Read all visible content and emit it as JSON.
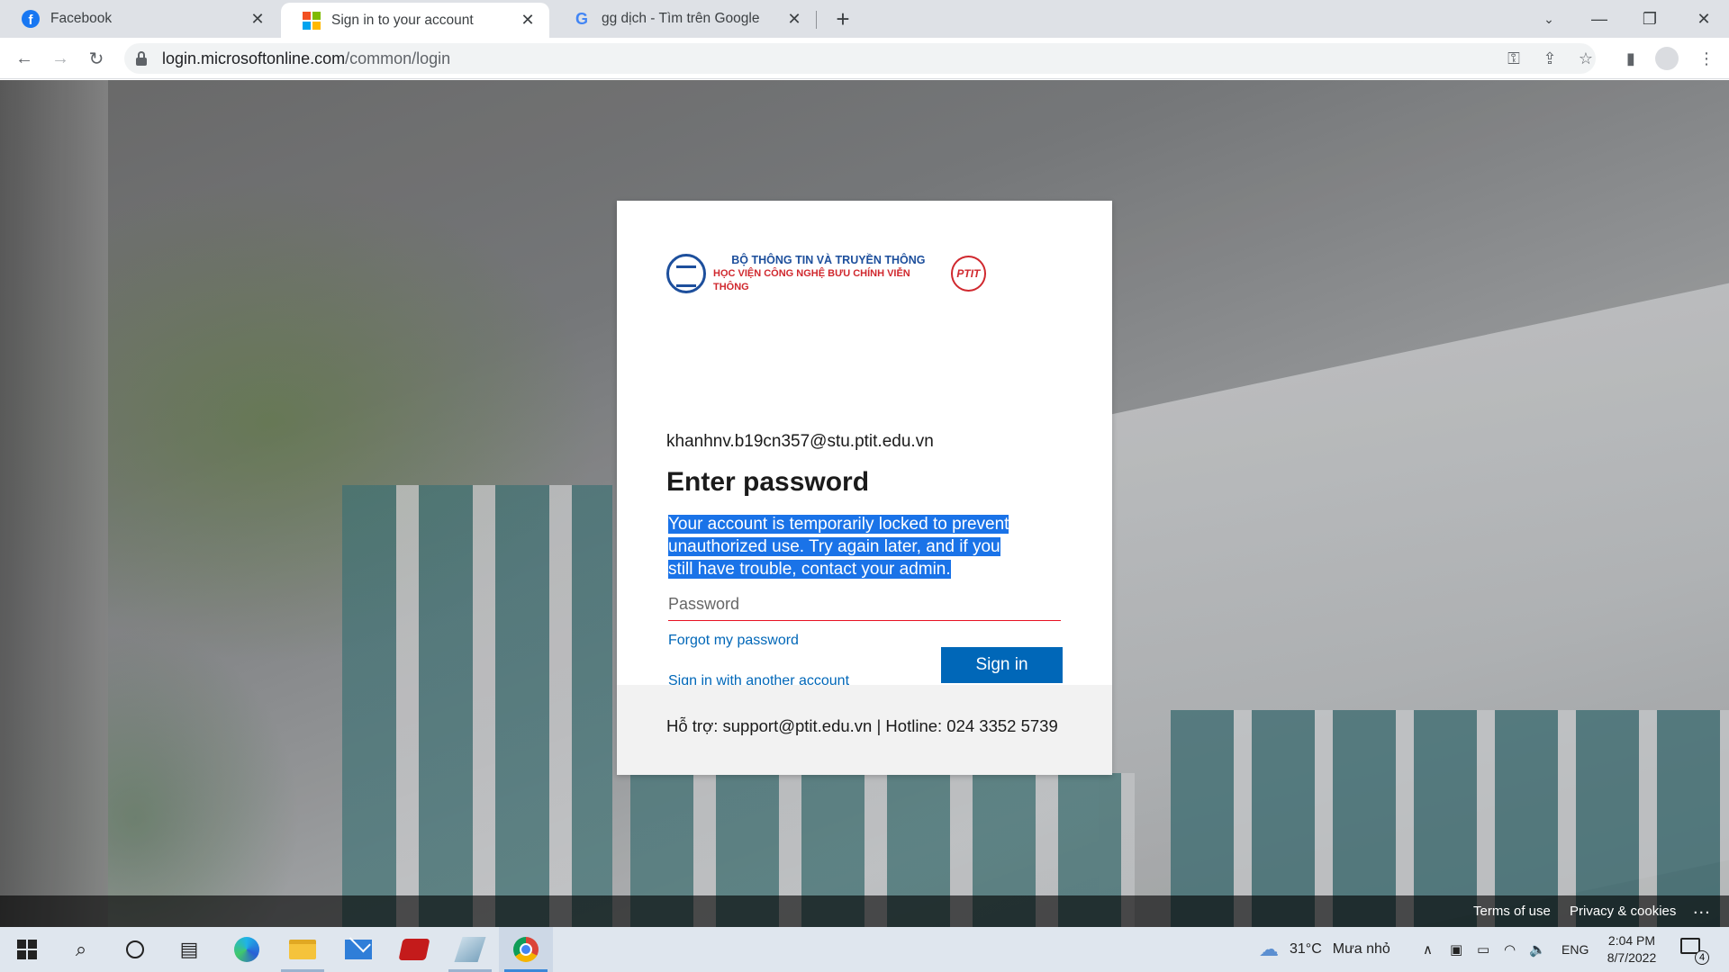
{
  "browser": {
    "tabs": [
      {
        "title": "Facebook",
        "favicon": "facebook-icon",
        "active": false
      },
      {
        "title": "Sign in to your account",
        "favicon": "microsoft-icon",
        "active": true
      },
      {
        "title": "gg dịch - Tìm trên Google",
        "favicon": "google-icon",
        "active": false
      }
    ],
    "url_host": "login.microsoftonline.com",
    "url_path": "/common/login"
  },
  "login": {
    "org_name_line1": "BỘ THÔNG TIN VÀ TRUYỀN THÔNG",
    "org_name_line2": "HỌC VIỆN CÔNG NGHỆ BƯU CHÍNH VIỄN THÔNG",
    "org_logo_text": "PTIT",
    "identity": "khanhnv.b19cn357@stu.ptit.edu.vn",
    "title": "Enter password",
    "error_message": "Your account is temporarily locked to prevent unauthorized use. Try again later, and if you still have trouble, contact your admin.",
    "password_placeholder": "Password",
    "forgot_password": "Forgot my password",
    "other_account": "Sign in with another account",
    "sign_in_button": "Sign in",
    "support_text": "Hỗ trợ: support@ptit.edu.vn | Hotline: 024 3352 5739",
    "colors": {
      "accent": "#0067b8",
      "error_underline": "#e81123",
      "selection": "#1a73e8"
    }
  },
  "page_footer": {
    "terms": "Terms of use",
    "privacy": "Privacy & cookies",
    "more": "..."
  },
  "taskbar": {
    "weather_temp": "31°C",
    "weather_desc": "Mưa nhỏ",
    "language": "ENG",
    "time": "2:04 PM",
    "date": "8/7/2022",
    "notification_count": "4"
  }
}
